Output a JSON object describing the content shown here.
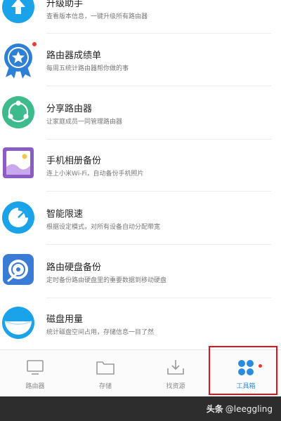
{
  "tools": [
    {
      "title": "升级助手",
      "desc": "查看版本信息，一键升级所有路由器",
      "icon": "upgrade-arrow-icon",
      "color": "#1aa3e8"
    },
    {
      "title": "路由器成绩单",
      "desc": "每周五统计路由器帮你做的事",
      "icon": "star-medal-icon",
      "color": "#2e7fd6"
    },
    {
      "title": "分享路由器",
      "desc": "让家庭成员一同管理路由器",
      "icon": "share-icon",
      "color": "#3dbb8c"
    },
    {
      "title": "手机相册备份",
      "desc": "连上小米Wi-Fi，自动备份手机照片",
      "icon": "photo-album-icon",
      "color": "#8b5cc4"
    },
    {
      "title": "智能限速",
      "desc": "根据设定模式，对所有设备自动分配带宽",
      "icon": "speed-limit-icon",
      "color": "#1aa3e8"
    },
    {
      "title": "路由硬盘备份",
      "desc": "定时备份路由硬盘里的重要数据到移动硬盘",
      "icon": "disk-backup-icon",
      "color": "#3a7bd5"
    },
    {
      "title": "磁盘用量",
      "desc": "统计磁盘空间占用，存储信息一目了然",
      "icon": "disk-usage-icon",
      "color": "#1aa3e8"
    }
  ],
  "tabs": [
    {
      "label": "路由器",
      "icon": "router-icon"
    },
    {
      "label": "存储",
      "icon": "folder-icon"
    },
    {
      "label": "找资源",
      "icon": "download-icon"
    },
    {
      "label": "工具箱",
      "icon": "toolbox-icon"
    }
  ],
  "active_tab": "工具箱",
  "accent_color": "#2b8cdf",
  "badge_color": "#f0392b",
  "highlight_color": "#e0121a",
  "watermark": {
    "brand": "头条",
    "handle": "@leeggling"
  }
}
